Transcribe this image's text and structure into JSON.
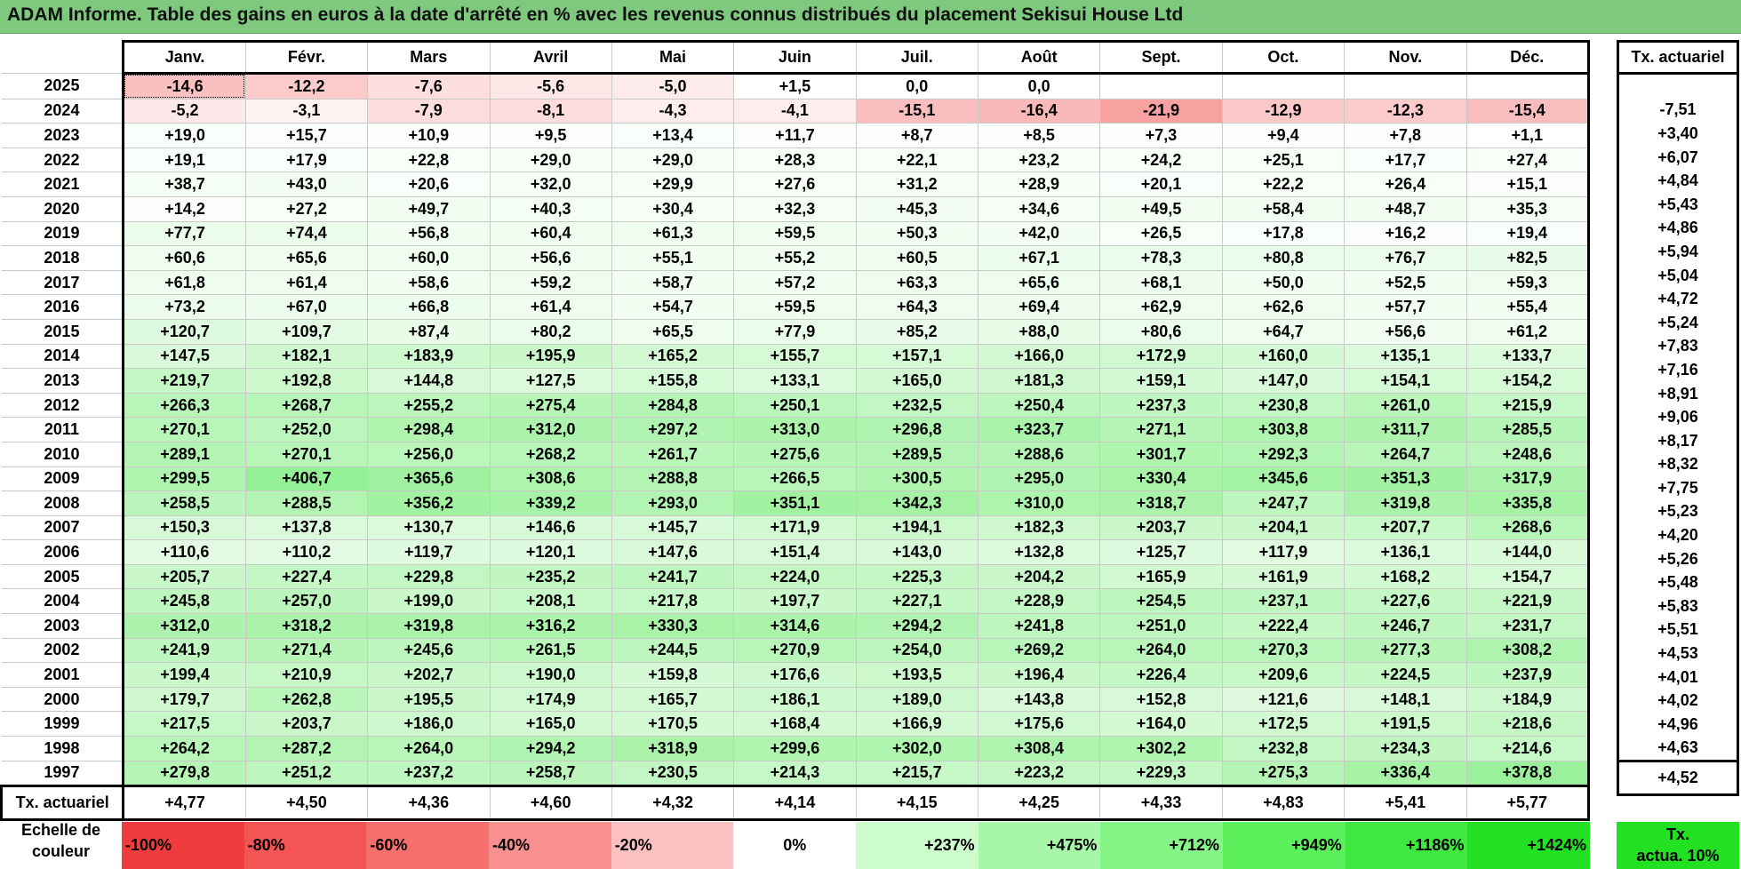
{
  "title": "ADAM Informe. Table des gains en euros à la date d'arrêté en % avec les revenus connus distribués du placement Sekisui House Ltd",
  "chart_data": {
    "type": "table",
    "months": [
      "Janv.",
      "Févr.",
      "Mars",
      "Avril",
      "Mai",
      "Juin",
      "Juil.",
      "Août",
      "Sept.",
      "Oct.",
      "Nov.",
      "Déc."
    ],
    "side_header": "Tx. actuariel",
    "rows": [
      {
        "year": "2025",
        "values": [
          "-14,6",
          "-12,2",
          "-7,6",
          "-5,6",
          "-5,0",
          "+1,5",
          "0,0",
          "0,0",
          "",
          "",
          "",
          ""
        ],
        "rate": ""
      },
      {
        "year": "2024",
        "values": [
          "-5,2",
          "-3,1",
          "-7,9",
          "-8,1",
          "-4,3",
          "-4,1",
          "-15,1",
          "-16,4",
          "-21,9",
          "-12,9",
          "-12,3",
          "-15,4"
        ],
        "rate": "-7,51"
      },
      {
        "year": "2023",
        "values": [
          "+19,0",
          "+15,7",
          "+10,9",
          "+9,5",
          "+13,4",
          "+11,7",
          "+8,7",
          "+8,5",
          "+7,3",
          "+9,4",
          "+7,8",
          "+1,1"
        ],
        "rate": "+3,40"
      },
      {
        "year": "2022",
        "values": [
          "+19,1",
          "+17,9",
          "+22,8",
          "+29,0",
          "+29,0",
          "+28,3",
          "+22,1",
          "+23,2",
          "+24,2",
          "+25,1",
          "+17,7",
          "+27,4"
        ],
        "rate": "+6,07"
      },
      {
        "year": "2021",
        "values": [
          "+38,7",
          "+43,0",
          "+20,6",
          "+32,0",
          "+29,9",
          "+27,6",
          "+31,2",
          "+28,9",
          "+20,1",
          "+22,2",
          "+26,4",
          "+15,1"
        ],
        "rate": "+4,84"
      },
      {
        "year": "2020",
        "values": [
          "+14,2",
          "+27,2",
          "+49,7",
          "+40,3",
          "+30,4",
          "+32,3",
          "+45,3",
          "+34,6",
          "+49,5",
          "+58,4",
          "+48,7",
          "+35,3"
        ],
        "rate": "+5,43"
      },
      {
        "year": "2019",
        "values": [
          "+77,7",
          "+74,4",
          "+56,8",
          "+60,4",
          "+61,3",
          "+59,5",
          "+50,3",
          "+42,0",
          "+26,5",
          "+17,8",
          "+16,2",
          "+19,4"
        ],
        "rate": "+4,86"
      },
      {
        "year": "2018",
        "values": [
          "+60,6",
          "+65,6",
          "+60,0",
          "+56,6",
          "+55,1",
          "+55,2",
          "+60,5",
          "+67,1",
          "+78,3",
          "+80,8",
          "+76,7",
          "+82,5"
        ],
        "rate": "+5,94"
      },
      {
        "year": "2017",
        "values": [
          "+61,8",
          "+61,4",
          "+58,6",
          "+59,2",
          "+58,7",
          "+57,2",
          "+63,3",
          "+65,6",
          "+68,1",
          "+50,0",
          "+52,5",
          "+59,3"
        ],
        "rate": "+5,04"
      },
      {
        "year": "2016",
        "values": [
          "+73,2",
          "+67,0",
          "+66,8",
          "+61,4",
          "+54,7",
          "+59,5",
          "+64,3",
          "+69,4",
          "+62,9",
          "+62,6",
          "+57,7",
          "+55,4"
        ],
        "rate": "+4,72"
      },
      {
        "year": "2015",
        "values": [
          "+120,7",
          "+109,7",
          "+87,4",
          "+80,2",
          "+65,5",
          "+77,9",
          "+85,2",
          "+88,0",
          "+80,6",
          "+64,7",
          "+56,6",
          "+61,2"
        ],
        "rate": "+5,24"
      },
      {
        "year": "2014",
        "values": [
          "+147,5",
          "+182,1",
          "+183,9",
          "+195,9",
          "+165,2",
          "+155,7",
          "+157,1",
          "+166,0",
          "+172,9",
          "+160,0",
          "+135,1",
          "+133,7"
        ],
        "rate": "+7,83"
      },
      {
        "year": "2013",
        "values": [
          "+219,7",
          "+192,8",
          "+144,8",
          "+127,5",
          "+155,8",
          "+133,1",
          "+165,0",
          "+181,3",
          "+159,1",
          "+147,0",
          "+154,1",
          "+154,2"
        ],
        "rate": "+7,16"
      },
      {
        "year": "2012",
        "values": [
          "+266,3",
          "+268,7",
          "+255,2",
          "+275,4",
          "+284,8",
          "+250,1",
          "+232,5",
          "+250,4",
          "+237,3",
          "+230,8",
          "+261,0",
          "+215,9"
        ],
        "rate": "+8,91"
      },
      {
        "year": "2011",
        "values": [
          "+270,1",
          "+252,0",
          "+298,4",
          "+312,0",
          "+297,2",
          "+313,0",
          "+296,8",
          "+323,7",
          "+271,1",
          "+303,8",
          "+311,7",
          "+285,5"
        ],
        "rate": "+9,06"
      },
      {
        "year": "2010",
        "values": [
          "+289,1",
          "+270,1",
          "+256,0",
          "+268,2",
          "+261,7",
          "+275,6",
          "+289,5",
          "+288,6",
          "+301,7",
          "+292,3",
          "+264,7",
          "+248,6"
        ],
        "rate": "+8,17"
      },
      {
        "year": "2009",
        "values": [
          "+299,5",
          "+406,7",
          "+365,6",
          "+308,6",
          "+288,8",
          "+266,5",
          "+300,5",
          "+295,0",
          "+330,4",
          "+345,6",
          "+351,3",
          "+317,9"
        ],
        "rate": "+8,32"
      },
      {
        "year": "2008",
        "values": [
          "+258,5",
          "+288,5",
          "+356,2",
          "+339,2",
          "+293,0",
          "+351,1",
          "+342,3",
          "+310,0",
          "+318,7",
          "+247,7",
          "+319,8",
          "+335,8"
        ],
        "rate": "+7,75"
      },
      {
        "year": "2007",
        "values": [
          "+150,3",
          "+137,8",
          "+130,7",
          "+146,6",
          "+145,7",
          "+171,9",
          "+194,1",
          "+182,3",
          "+203,7",
          "+204,1",
          "+207,7",
          "+268,6"
        ],
        "rate": "+5,23"
      },
      {
        "year": "2006",
        "values": [
          "+110,6",
          "+110,2",
          "+119,7",
          "+120,1",
          "+147,6",
          "+151,4",
          "+143,0",
          "+132,8",
          "+125,7",
          "+117,9",
          "+136,1",
          "+144,0"
        ],
        "rate": "+4,20"
      },
      {
        "year": "2005",
        "values": [
          "+205,7",
          "+227,4",
          "+229,8",
          "+235,2",
          "+241,7",
          "+224,0",
          "+225,3",
          "+204,2",
          "+165,9",
          "+161,9",
          "+168,2",
          "+154,7"
        ],
        "rate": "+5,26"
      },
      {
        "year": "2004",
        "values": [
          "+245,8",
          "+257,0",
          "+199,0",
          "+208,1",
          "+217,8",
          "+197,7",
          "+227,1",
          "+228,9",
          "+254,5",
          "+237,1",
          "+227,6",
          "+221,9"
        ],
        "rate": "+5,48"
      },
      {
        "year": "2003",
        "values": [
          "+312,0",
          "+318,2",
          "+319,8",
          "+316,2",
          "+330,3",
          "+314,6",
          "+294,2",
          "+241,8",
          "+251,0",
          "+222,4",
          "+246,7",
          "+231,7"
        ],
        "rate": "+5,83"
      },
      {
        "year": "2002",
        "values": [
          "+241,9",
          "+271,4",
          "+245,6",
          "+261,5",
          "+244,5",
          "+270,9",
          "+254,0",
          "+269,2",
          "+264,0",
          "+270,3",
          "+277,3",
          "+308,2"
        ],
        "rate": "+5,51"
      },
      {
        "year": "2001",
        "values": [
          "+199,4",
          "+210,9",
          "+202,7",
          "+190,0",
          "+159,8",
          "+176,6",
          "+193,5",
          "+196,4",
          "+226,4",
          "+209,6",
          "+224,5",
          "+237,9"
        ],
        "rate": "+4,53"
      },
      {
        "year": "2000",
        "values": [
          "+179,7",
          "+262,8",
          "+195,5",
          "+174,9",
          "+165,7",
          "+186,1",
          "+189,0",
          "+143,8",
          "+152,8",
          "+121,6",
          "+148,1",
          "+184,9"
        ],
        "rate": "+4,01"
      },
      {
        "year": "1999",
        "values": [
          "+217,5",
          "+203,7",
          "+186,0",
          "+165,0",
          "+170,5",
          "+168,4",
          "+166,9",
          "+175,6",
          "+164,0",
          "+172,5",
          "+191,5",
          "+218,6"
        ],
        "rate": "+4,02"
      },
      {
        "year": "1998",
        "values": [
          "+264,2",
          "+287,2",
          "+264,0",
          "+294,2",
          "+318,9",
          "+299,6",
          "+302,0",
          "+308,4",
          "+302,2",
          "+232,8",
          "+234,3",
          "+214,6"
        ],
        "rate": "+4,96"
      },
      {
        "year": "1997",
        "values": [
          "+279,8",
          "+251,2",
          "+237,2",
          "+258,7",
          "+230,5",
          "+214,3",
          "+215,7",
          "+223,2",
          "+229,3",
          "+275,3",
          "+336,4",
          "+378,8"
        ],
        "rate": "+4,63"
      }
    ],
    "footer": {
      "label": "Tx. actuariel",
      "values": [
        "+4,77",
        "+4,50",
        "+4,36",
        "+4,60",
        "+4,32",
        "+4,14",
        "+4,15",
        "+4,25",
        "+4,33",
        "+4,83",
        "+5,41",
        "+5,77"
      ],
      "rate": "+4,52"
    },
    "legend": {
      "label_line1": "Echelle de",
      "label_line2": "couleur",
      "cells": [
        {
          "text": "-100%",
          "color": "#f03c3c",
          "kind": "neg"
        },
        {
          "text": "-80%",
          "color": "#f35555",
          "kind": "neg"
        },
        {
          "text": "-60%",
          "color": "#f66e6e",
          "kind": "neg"
        },
        {
          "text": "-40%",
          "color": "#f99090",
          "kind": "neg"
        },
        {
          "text": "-20%",
          "color": "#fcc0c0",
          "kind": "neg"
        },
        {
          "text": "0%",
          "color": "#ffffff",
          "kind": "zero"
        },
        {
          "text": "+237%",
          "color": "#ccfccc",
          "kind": "pos"
        },
        {
          "text": "+475%",
          "color": "#a8f7a8",
          "kind": "pos"
        },
        {
          "text": "+712%",
          "color": "#86f486",
          "kind": "pos"
        },
        {
          "text": "+949%",
          "color": "#5cef5c",
          "kind": "pos"
        },
        {
          "text": "+1186%",
          "color": "#3fe83f",
          "kind": "pos"
        },
        {
          "text": "+1424%",
          "color": "#22e022",
          "kind": "pos"
        }
      ],
      "rate_line1": "Tx.",
      "rate_line2": "actua. 10%",
      "rate_color": "#22e022"
    }
  }
}
